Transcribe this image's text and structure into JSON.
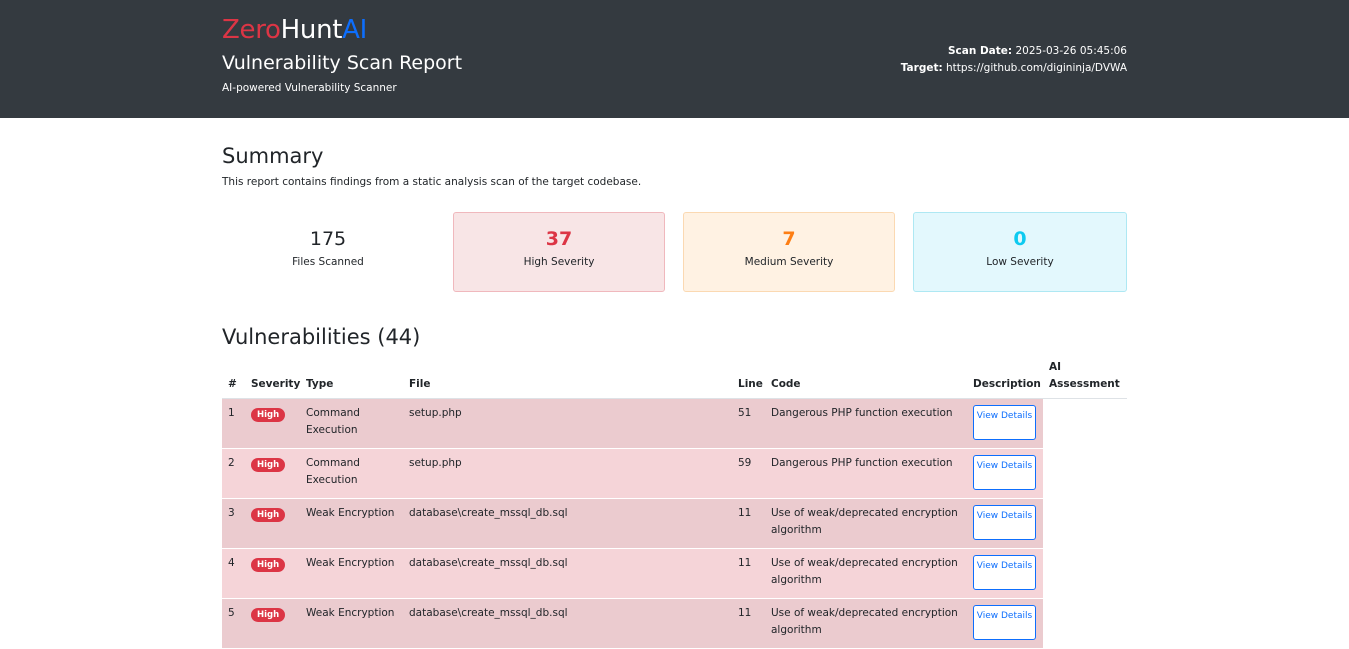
{
  "header": {
    "logo": {
      "part1": "Zero",
      "part2": "Hunt",
      "part3": "AI"
    },
    "title": "Vulnerability Scan Report",
    "subtitle": "AI-powered Vulnerability Scanner",
    "scan_date_label": "Scan Date:",
    "scan_date": "2025-03-26 05:45:06",
    "target_label": "Target:",
    "target": "https://github.com/digininja/DVWA"
  },
  "summary": {
    "title": "Summary",
    "text": "This report contains findings from a static analysis scan of the target codebase.",
    "cards": [
      {
        "value": "175",
        "label": "Files Scanned"
      },
      {
        "value": "37",
        "label": "High Severity"
      },
      {
        "value": "7",
        "label": "Medium Severity"
      },
      {
        "value": "0",
        "label": "Low Severity"
      }
    ]
  },
  "vulnerabilities": {
    "title": "Vulnerabilities (44)",
    "columns": [
      "#",
      "Severity",
      "Type",
      "File",
      "Line",
      "Code",
      "Description",
      "AI Assessment"
    ],
    "rows": [
      {
        "num": "1",
        "severity": "High",
        "type": "Command Execution",
        "file": "setup.php",
        "line": "51",
        "code": "Dangerous PHP function execution",
        "button": "View Details"
      },
      {
        "num": "2",
        "severity": "High",
        "type": "Command Execution",
        "file": "setup.php",
        "line": "59",
        "code": "Dangerous PHP function execution",
        "button": "View Details"
      },
      {
        "num": "3",
        "severity": "High",
        "type": "Weak Encryption",
        "file": "database\\create_mssql_db.sql",
        "line": "11",
        "code": "Use of weak/deprecated encryption algorithm",
        "button": "View Details"
      },
      {
        "num": "4",
        "severity": "High",
        "type": "Weak Encryption",
        "file": "database\\create_mssql_db.sql",
        "line": "11",
        "code": "Use of weak/deprecated encryption algorithm",
        "button": "View Details"
      },
      {
        "num": "5",
        "severity": "High",
        "type": "Weak Encryption",
        "file": "database\\create_mssql_db.sql",
        "line": "11",
        "code": "Use of weak/deprecated encryption algorithm",
        "button": "View Details"
      }
    ]
  }
}
